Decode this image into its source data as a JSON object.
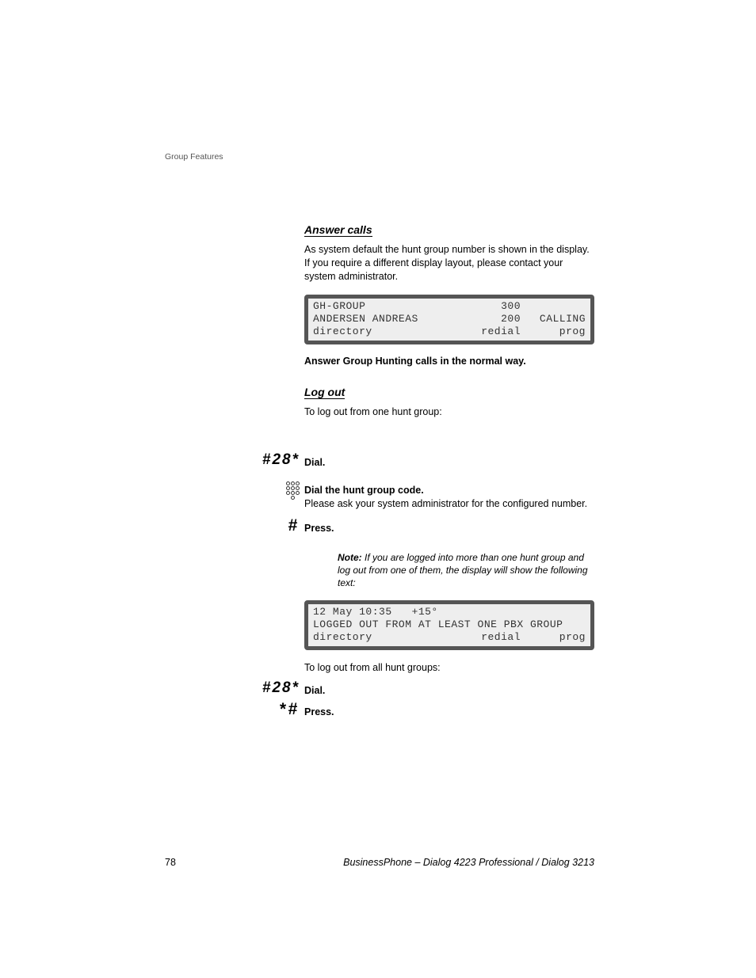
{
  "header": {
    "section": "Group Features"
  },
  "answer": {
    "title": "Answer calls",
    "intro": "As system default the hunt group number is shown in the display. If you require a different display layout, please contact your system administrator.",
    "lcd": {
      "r1": {
        "left": "GH-GROUP",
        "mid": "300",
        "right": ""
      },
      "r2": {
        "left": "ANDERSEN ANDREAS",
        "mid": "200",
        "right": "CALLING"
      },
      "r3": {
        "left": "directory",
        "mid": "redial",
        "right": "prog"
      }
    },
    "normal": "Answer Group Hunting calls in the normal way."
  },
  "logout": {
    "title": "Log out",
    "intro": "To log out from one hunt group:",
    "step1": {
      "code": "#28*",
      "label": "Dial."
    },
    "step2": {
      "head": "Dial the hunt group code.",
      "body": "Please ask your system administrator for the configured number."
    },
    "step3": {
      "key": "#",
      "label": "Press."
    },
    "note": {
      "label": "Note:",
      "text": " If you are logged into more than one hunt group and log out from one of them, the display will show the following text:"
    },
    "lcd": {
      "r1": "12 May 10:35   +15°",
      "r2": "LOGGED OUT FROM AT LEAST ONE PBX GROUP",
      "r3": {
        "left": "directory",
        "mid": "redial",
        "right": "prog"
      }
    },
    "all_intro": "To log out from all hunt groups:",
    "step4": {
      "code": "#28*",
      "label": "Dial."
    },
    "step5": {
      "key": "*#",
      "label": "Press."
    }
  },
  "footer": {
    "page": "78",
    "title": "BusinessPhone – Dialog 4223 Professional / Dialog 3213"
  }
}
